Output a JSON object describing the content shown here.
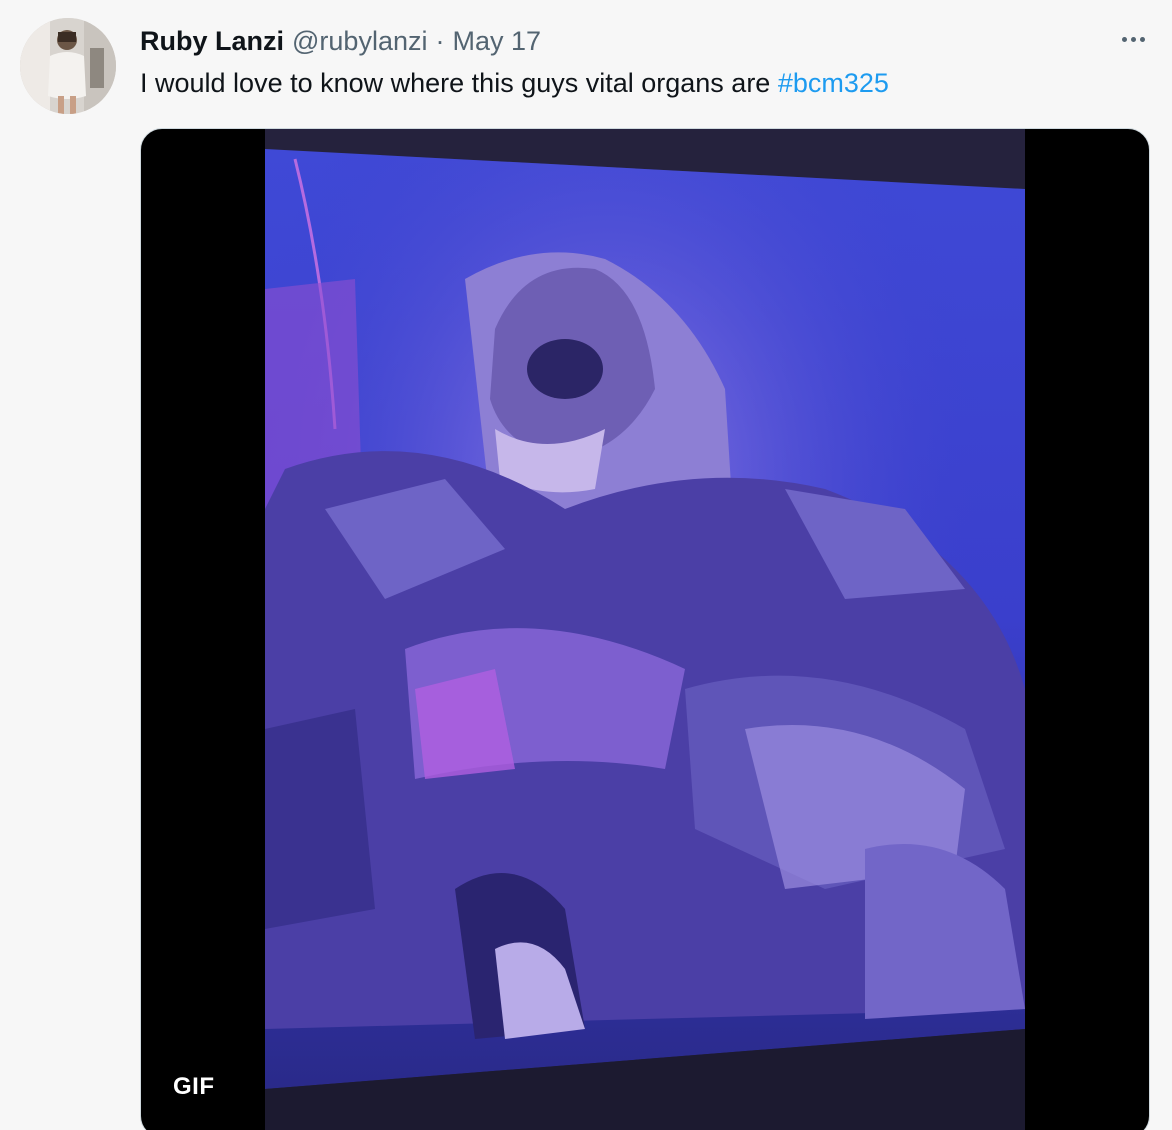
{
  "author": {
    "display_name": "Ruby Lanzi",
    "handle": "@rubylanzi",
    "separator": "·",
    "date": "May 17"
  },
  "tweet": {
    "text": "I would love to know where this guys vital organs are ",
    "hashtag": "#bcm325"
  },
  "media": {
    "badge": "GIF"
  },
  "icons": {
    "more": "more-horizontal-icon"
  },
  "colors": {
    "hashtag": "#1d9bf0",
    "secondary_text": "#536471",
    "primary_text": "#0f1419"
  }
}
